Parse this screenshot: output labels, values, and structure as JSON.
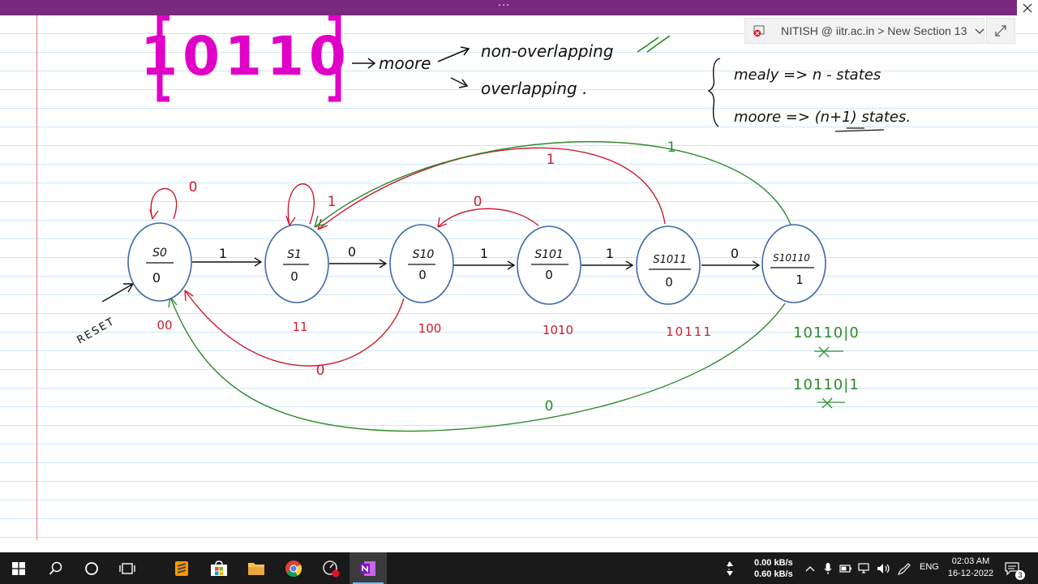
{
  "window": {
    "title_dots": "···"
  },
  "breadcrumb": {
    "text": "NITISH @ iitr.ac.in > New Section 13"
  },
  "notes": {
    "sequence": "10110",
    "moore": "moore",
    "non_overlapping": "non-overlapping",
    "overlapping": "overlapping .",
    "mealy_rule": "mealy => n - states",
    "moore_rule": "moore => (n+1) states."
  },
  "diagram": {
    "states": [
      {
        "name": "S0",
        "output": "0",
        "history": "00"
      },
      {
        "name": "S1",
        "output": "0",
        "history": "11"
      },
      {
        "name": "S10",
        "output": "0",
        "history": "100"
      },
      {
        "name": "S101",
        "output": "0",
        "history": "1010"
      },
      {
        "name": "S1011",
        "output": "0",
        "history": "10111"
      },
      {
        "name": "S10110",
        "output": "1",
        "history": ""
      }
    ],
    "forward_inputs": [
      "1",
      "0",
      "1",
      "1",
      "0"
    ],
    "self_loop_s0": "0",
    "self_loop_s1": "1",
    "back_s101_s10": "0",
    "back_s1011_s1": "1",
    "back_s10110_s1": "1",
    "back_s10_s0": "0",
    "back_s10110_s0": "0",
    "reset": "RESET",
    "side_note_1": "10110|0",
    "side_note_2": "10110|1"
  },
  "taskbar": {
    "net_down": "0.00 kB/s",
    "net_up": "0.60 kB/s",
    "lang": "ENG",
    "time": "02:03 AM",
    "date": "16-12-2022",
    "notifications": "3"
  }
}
